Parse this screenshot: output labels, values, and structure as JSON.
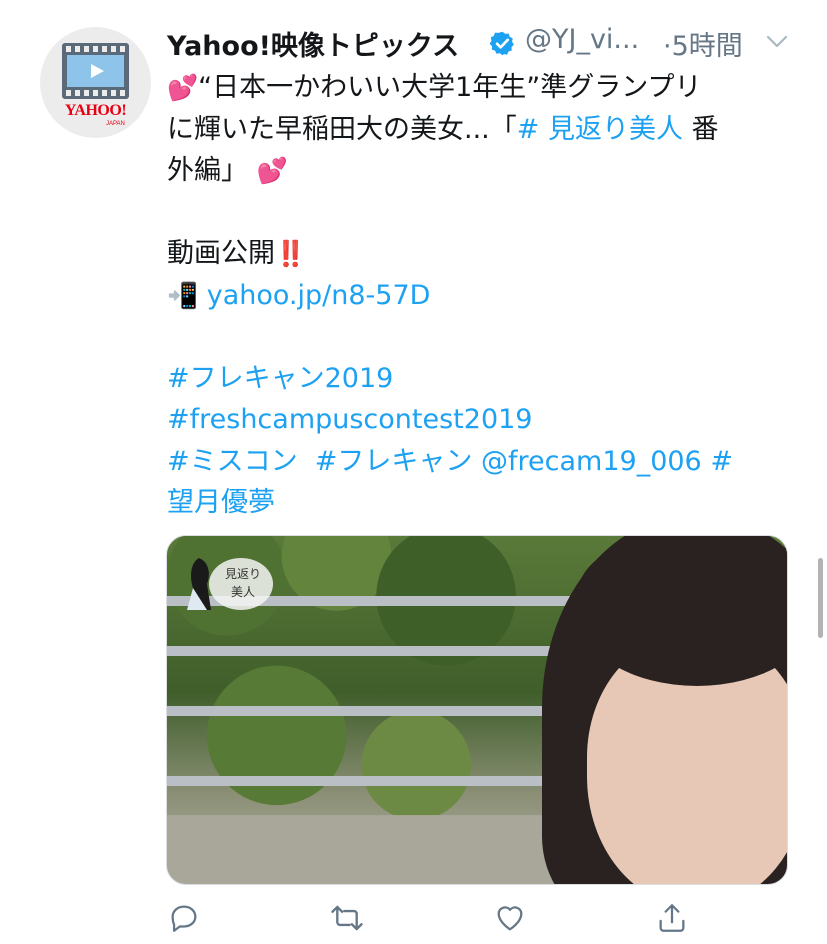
{
  "tweet": {
    "author": {
      "display_name": "Yahoo!映像トピックス",
      "handle": "@YJ_vi...",
      "verified": true,
      "avatar": {
        "logo_text": "YAHOO!",
        "logo_sub": "JAPAN"
      }
    },
    "time": "·5時間",
    "text": {
      "line1_emoji": "💕",
      "line1": "“日本一かわいい大学1年生”準グランプリ",
      "line2_prefix": "に輝いた早稲田大の美女...「",
      "line2_hashtag": "# 見返り美人",
      "line2_suffix": " 番",
      "line3": "外編」",
      "line3_emoji": "💕",
      "line4": "動画公開",
      "line4_emoji": "‼️",
      "line5_emoji": "📲",
      "line5_link": "yahoo.jp/n8-57D",
      "hashtag1": "#フレキャン2019",
      "hashtag2": "#freshcampuscontest2019",
      "hashtag3": "#ミスコン",
      "hashtag4": "#フレキャン",
      "mention": "@frecam19_006",
      "hashtag5_start": "#",
      "hashtag5_end": "望月優夢"
    },
    "media": {
      "badge_text": "見返り美人"
    },
    "actions": [
      {
        "name": "reply",
        "icon": "reply-icon"
      },
      {
        "name": "retweet",
        "icon": "retweet-icon"
      },
      {
        "name": "like",
        "icon": "heart-icon"
      },
      {
        "name": "share",
        "icon": "share-icon"
      }
    ]
  },
  "colors": {
    "link": "#1da1f2",
    "text": "#14171a",
    "secondary": "#657786"
  }
}
